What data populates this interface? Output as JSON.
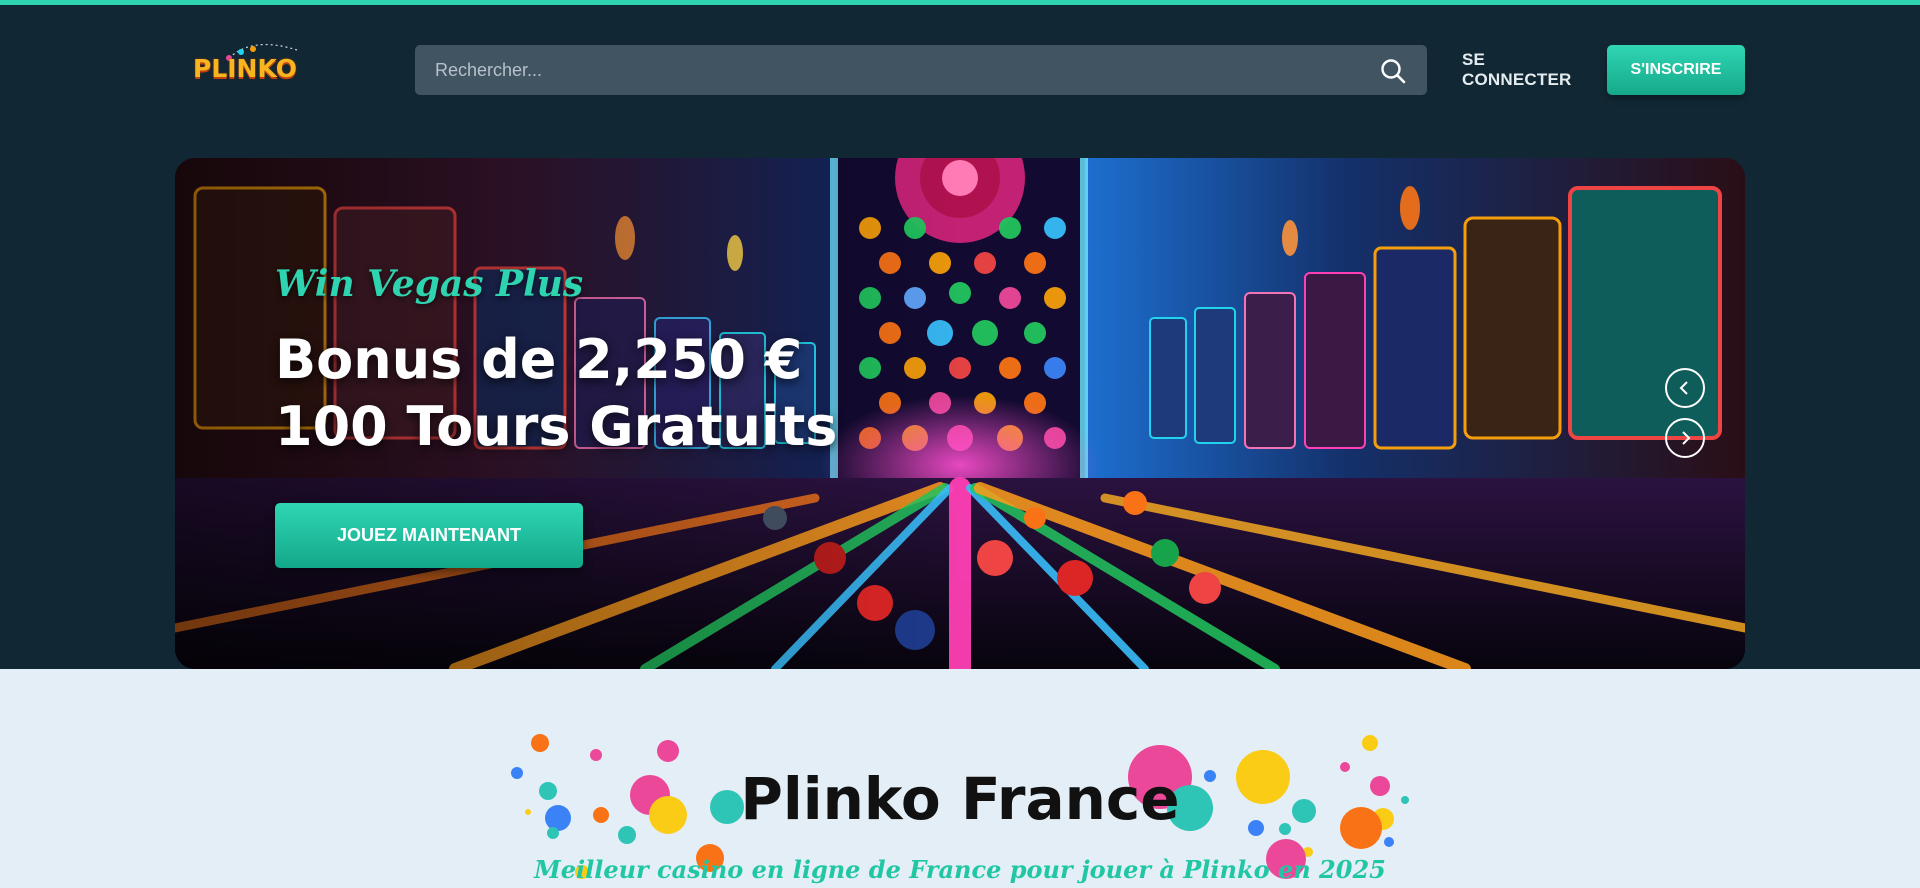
{
  "brand": {
    "logo_text": "PLINKO",
    "accent": "#2ed3b0",
    "bg_dark": "#112834"
  },
  "search": {
    "placeholder": "Rechercher...",
    "icon": "search-icon"
  },
  "auth": {
    "login_label": "SE CONNECTER",
    "signup_label": "S'INSCRIRE"
  },
  "hero": {
    "kicker": "Win Vegas Plus",
    "title_line1": "Bonus de 2,250 €",
    "title_line2": "100 Tours Gratuits",
    "cta_label": "JOUEZ MAINTENANT",
    "prev_icon": "chevron-left-icon",
    "next_icon": "chevron-right-icon"
  },
  "section": {
    "title": "Plinko France",
    "subtitle": "Meilleur casino en ligne de France pour jouer à Plinko en 2025"
  }
}
